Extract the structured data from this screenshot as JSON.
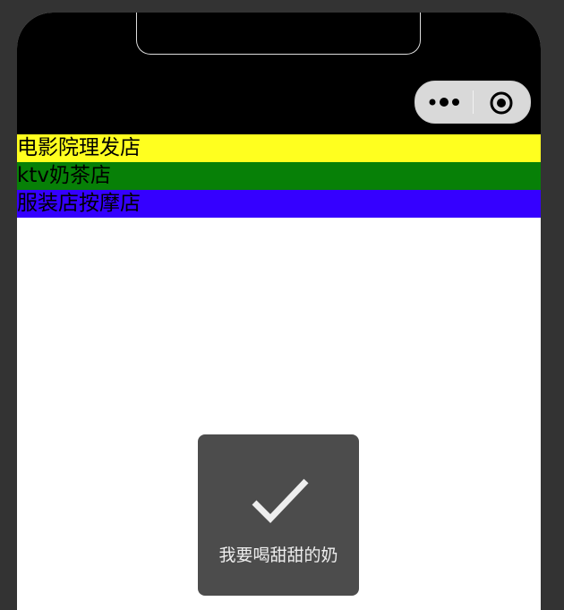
{
  "colors": {
    "background": "#333333",
    "nav_bar": "#000000",
    "row_1": "#ffff1f",
    "row_2": "#078007",
    "row_3": "#3500ff",
    "toast": "#4c4c4c"
  },
  "capsule": {
    "more_icon": "more-dots-icon",
    "close_icon": "target-circle-icon"
  },
  "rows": [
    {
      "label": "电影院理发店"
    },
    {
      "label": "ktv奶茶店"
    },
    {
      "label": "服装店按摩店"
    }
  ],
  "toast": {
    "icon": "checkmark-icon",
    "message": "我要喝甜甜的奶"
  }
}
